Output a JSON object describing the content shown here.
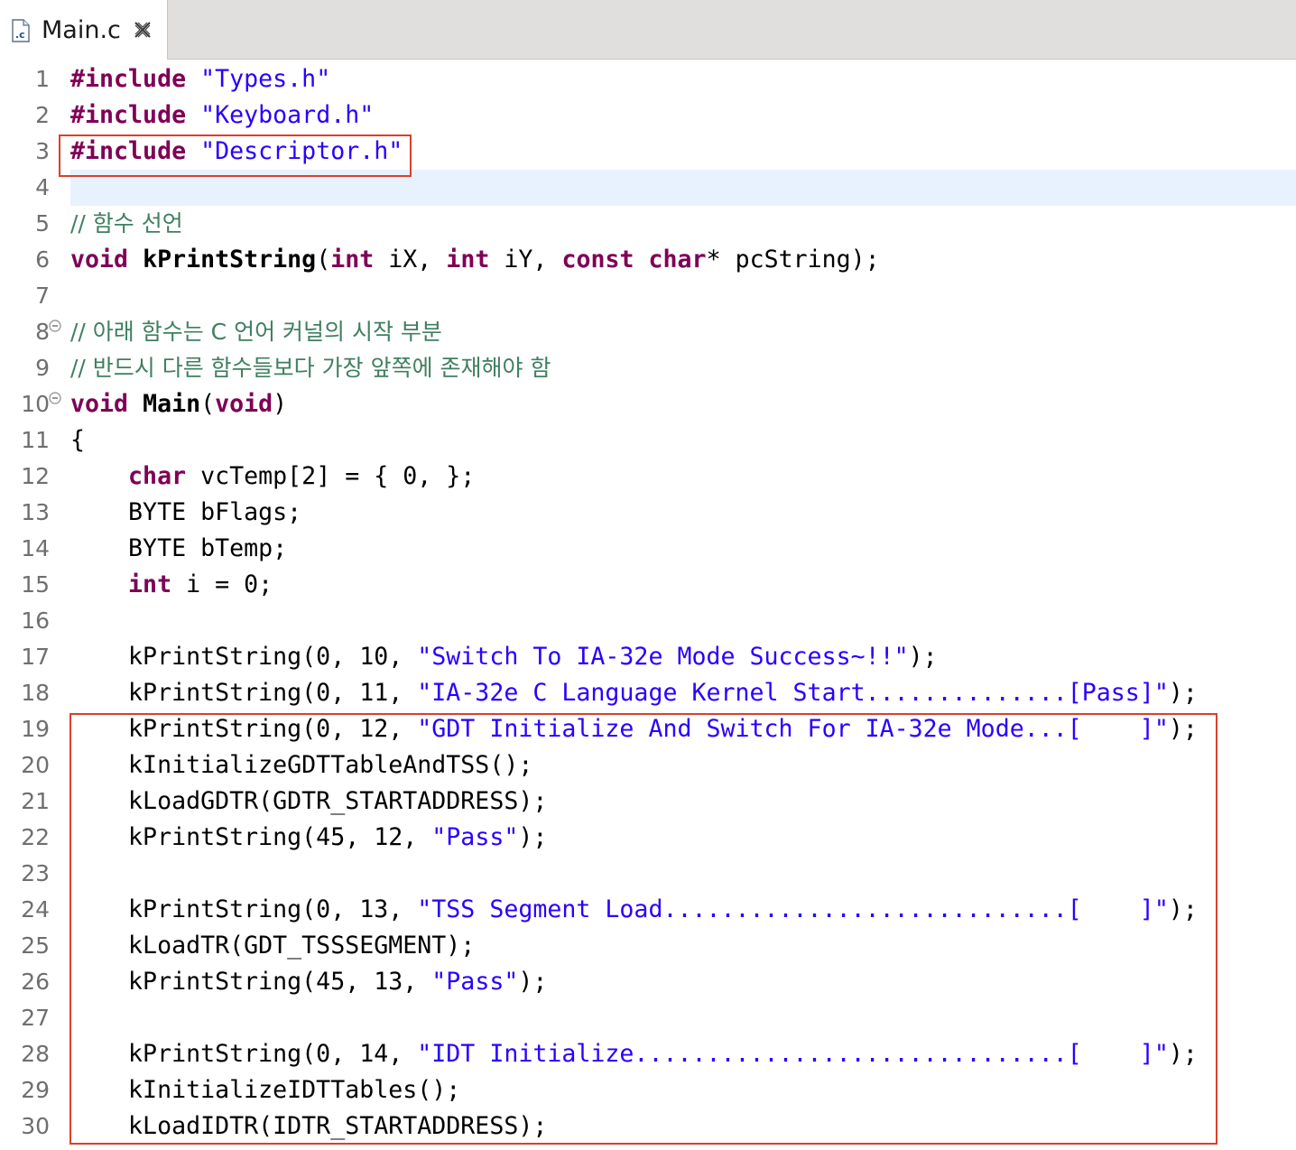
{
  "tab": {
    "title": "Main.c",
    "file_icon": "c-file-icon",
    "close_icon": "close-icon"
  },
  "editor": {
    "lines": [
      {
        "n": "1",
        "segs": [
          {
            "t": "#include",
            "c": "kw"
          },
          {
            "t": " "
          },
          {
            "t": "\"Types.h\"",
            "c": "str"
          }
        ]
      },
      {
        "n": "2",
        "segs": [
          {
            "t": "#include",
            "c": "kw"
          },
          {
            "t": " "
          },
          {
            "t": "\"Keyboard.h\"",
            "c": "str"
          }
        ]
      },
      {
        "n": "3",
        "segs": [
          {
            "t": "#include",
            "c": "kw"
          },
          {
            "t": " "
          },
          {
            "t": "\"Descriptor.h\"",
            "c": "str"
          }
        ]
      },
      {
        "n": "4",
        "segs": []
      },
      {
        "n": "5",
        "segs": [
          {
            "t": "// 함수 선언",
            "c": "cm"
          }
        ]
      },
      {
        "n": "6",
        "segs": [
          {
            "t": "void",
            "c": "kw"
          },
          {
            "t": " "
          },
          {
            "t": "kPrintString",
            "c": "fn"
          },
          {
            "t": "("
          },
          {
            "t": "int",
            "c": "kw"
          },
          {
            "t": " iX, "
          },
          {
            "t": "int",
            "c": "kw"
          },
          {
            "t": " iY, "
          },
          {
            "t": "const",
            "c": "kw"
          },
          {
            "t": " "
          },
          {
            "t": "char",
            "c": "kw"
          },
          {
            "t": "* pcString);"
          }
        ]
      },
      {
        "n": "7",
        "segs": []
      },
      {
        "n": "8",
        "fold": true,
        "segs": [
          {
            "t": "// 아래 함수는 C 언어 커널의 시작 부분",
            "c": "cm"
          }
        ]
      },
      {
        "n": "9",
        "segs": [
          {
            "t": "// 반드시 다른 함수들보다 가장 앞쪽에 존재해야 함",
            "c": "cm"
          }
        ]
      },
      {
        "n": "10",
        "fold": true,
        "segs": [
          {
            "t": "void",
            "c": "kw"
          },
          {
            "t": " "
          },
          {
            "t": "Main",
            "c": "fn"
          },
          {
            "t": "("
          },
          {
            "t": "void",
            "c": "kw"
          },
          {
            "t": ")"
          }
        ]
      },
      {
        "n": "11",
        "segs": [
          {
            "t": "{"
          }
        ]
      },
      {
        "n": "12",
        "segs": [
          {
            "t": "    "
          },
          {
            "t": "char",
            "c": "kw"
          },
          {
            "t": " vcTemp[2] = { 0, };"
          }
        ]
      },
      {
        "n": "13",
        "segs": [
          {
            "t": "    BYTE bFlags;"
          }
        ]
      },
      {
        "n": "14",
        "segs": [
          {
            "t": "    BYTE bTemp;"
          }
        ]
      },
      {
        "n": "15",
        "segs": [
          {
            "t": "    "
          },
          {
            "t": "int",
            "c": "kw"
          },
          {
            "t": " i = 0;"
          }
        ]
      },
      {
        "n": "16",
        "segs": []
      },
      {
        "n": "17",
        "segs": [
          {
            "t": "    kPrintString(0, 10, "
          },
          {
            "t": "\"Switch To IA-32e Mode Success~!!\"",
            "c": "str"
          },
          {
            "t": ");"
          }
        ]
      },
      {
        "n": "18",
        "segs": [
          {
            "t": "    kPrintString(0, 11, "
          },
          {
            "t": "\"IA-32e C Language Kernel Start..............[Pass]\"",
            "c": "str"
          },
          {
            "t": ");"
          }
        ]
      },
      {
        "n": "19",
        "segs": [
          {
            "t": "    kPrintString(0, 12, "
          },
          {
            "t": "\"GDT Initialize And Switch For IA-32e Mode...[    ]\"",
            "c": "str"
          },
          {
            "t": ");"
          }
        ]
      },
      {
        "n": "20",
        "segs": [
          {
            "t": "    kInitializeGDTTableAndTSS();"
          }
        ]
      },
      {
        "n": "21",
        "segs": [
          {
            "t": "    kLoadGDTR(GDTR_STARTADDRESS);"
          }
        ]
      },
      {
        "n": "22",
        "segs": [
          {
            "t": "    kPrintString(45, 12, "
          },
          {
            "t": "\"Pass\"",
            "c": "str"
          },
          {
            "t": ");"
          }
        ]
      },
      {
        "n": "23",
        "segs": []
      },
      {
        "n": "24",
        "segs": [
          {
            "t": "    kPrintString(0, 13, "
          },
          {
            "t": "\"TSS Segment Load............................[    ]\"",
            "c": "str"
          },
          {
            "t": ");"
          }
        ]
      },
      {
        "n": "25",
        "segs": [
          {
            "t": "    kLoadTR(GDT_TSSSEGMENT);"
          }
        ]
      },
      {
        "n": "26",
        "segs": [
          {
            "t": "    kPrintString(45, 13, "
          },
          {
            "t": "\"Pass\"",
            "c": "str"
          },
          {
            "t": ");"
          }
        ]
      },
      {
        "n": "27",
        "segs": []
      },
      {
        "n": "28",
        "segs": [
          {
            "t": "    kPrintString(0, 14, "
          },
          {
            "t": "\"IDT Initialize..............................[    ]\"",
            "c": "str"
          },
          {
            "t": ");"
          }
        ]
      },
      {
        "n": "29",
        "segs": [
          {
            "t": "    kInitializeIDTTables();"
          }
        ]
      },
      {
        "n": "30",
        "segs": [
          {
            "t": "    kLoadIDTR(IDTR_STARTADDRESS);"
          }
        ]
      }
    ],
    "current_line": "4",
    "highlight_color": "#d9402b"
  }
}
